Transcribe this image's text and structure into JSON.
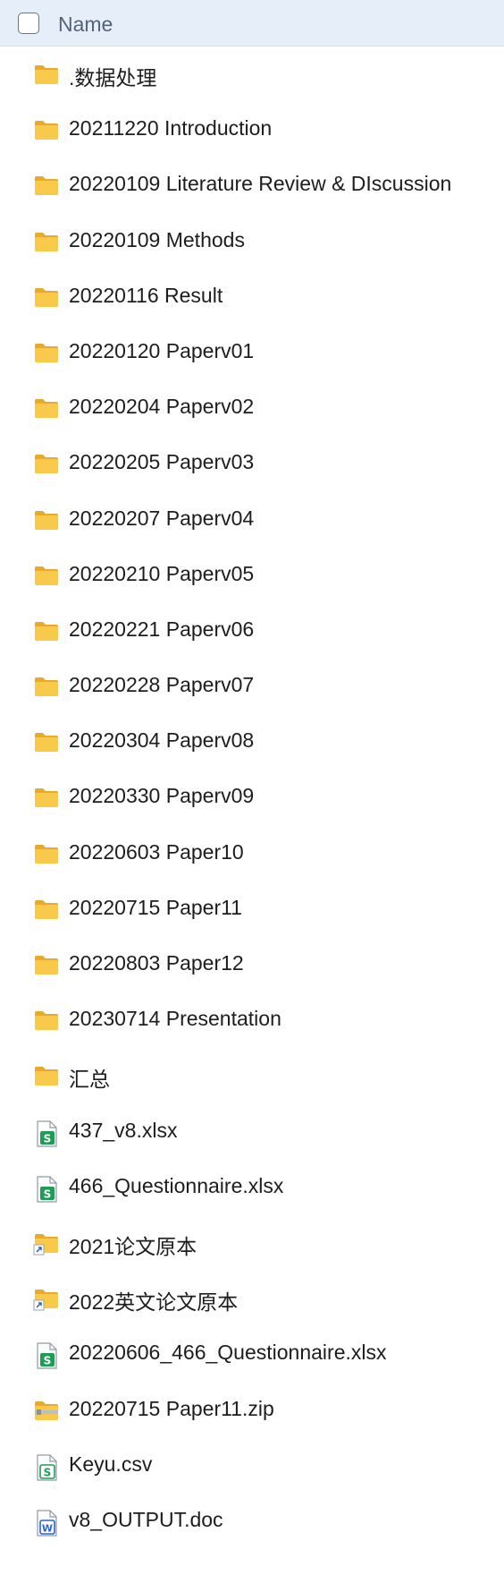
{
  "header": {
    "name_label": "Name"
  },
  "items": [
    {
      "name": ".数据处理",
      "icon": "folder-icon"
    },
    {
      "name": "20211220 Introduction",
      "icon": "folder-icon"
    },
    {
      "name": "20220109 Literature Review & DIscussion",
      "icon": "folder-icon"
    },
    {
      "name": "20220109 Methods",
      "icon": "folder-icon"
    },
    {
      "name": "20220116 Result",
      "icon": "folder-icon"
    },
    {
      "name": "20220120 Paperv01",
      "icon": "folder-icon"
    },
    {
      "name": "20220204 Paperv02",
      "icon": "folder-icon"
    },
    {
      "name": "20220205 Paperv03",
      "icon": "folder-icon"
    },
    {
      "name": "20220207 Paperv04",
      "icon": "folder-icon"
    },
    {
      "name": "20220210 Paperv05",
      "icon": "folder-icon"
    },
    {
      "name": "20220221 Paperv06",
      "icon": "folder-icon"
    },
    {
      "name": "20220228 Paperv07",
      "icon": "folder-icon"
    },
    {
      "name": "20220304 Paperv08",
      "icon": "folder-icon"
    },
    {
      "name": "20220330 Paperv09",
      "icon": "folder-icon"
    },
    {
      "name": "20220603 Paper10",
      "icon": "folder-icon"
    },
    {
      "name": "20220715 Paper11",
      "icon": "folder-icon"
    },
    {
      "name": "20220803 Paper12",
      "icon": "folder-icon"
    },
    {
      "name": "20230714 Presentation",
      "icon": "folder-icon"
    },
    {
      "name": "汇总",
      "icon": "folder-icon"
    },
    {
      "name": "437_v8.xlsx",
      "icon": "spreadsheet-file-icon"
    },
    {
      "name": "466_Questionnaire.xlsx",
      "icon": "spreadsheet-file-icon"
    },
    {
      "name": "2021论文原本",
      "icon": "folder-shortcut-icon"
    },
    {
      "name": "2022英文论文原本",
      "icon": "folder-shortcut-icon"
    },
    {
      "name": "20220606_466_Questionnaire.xlsx",
      "icon": "spreadsheet-file-icon"
    },
    {
      "name": "20220715 Paper11.zip",
      "icon": "zip-folder-icon"
    },
    {
      "name": "Keyu.csv",
      "icon": "csv-file-icon"
    },
    {
      "name": "v8_OUTPUT.doc",
      "icon": "word-document-icon"
    }
  ],
  "colors": {
    "folder": "#f8c94a",
    "folder_back": "#e9a92a",
    "spreadsheet": "#1f9d55",
    "word": "#2b63d4",
    "header_bg": "#e6eef9"
  }
}
